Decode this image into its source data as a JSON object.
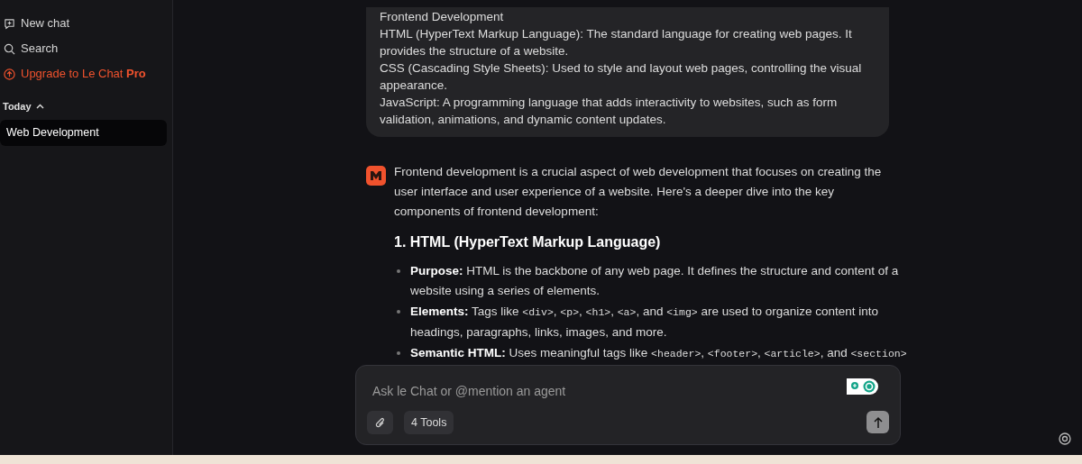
{
  "sidebar": {
    "actions": [
      {
        "kind": "new_chat",
        "label": "New chat"
      },
      {
        "kind": "search",
        "label": "Search"
      },
      {
        "kind": "upgrade",
        "label": "Upgrade to Le Chat **Pro**"
      }
    ],
    "section": {
      "title": "Today",
      "expanded": true
    },
    "chats": [
      {
        "title": "Web Development",
        "selected": true
      }
    ]
  },
  "user_message": {
    "lines": [
      "Frontend Development",
      "HTML (HyperText Markup Language): The standard language for creating web pages. It provides the structure of a website.",
      "CSS (Cascading Style Sheets): Used to style and layout web pages, controlling the visual appearance.",
      "JavaScript: A programming language that adds interactivity to websites, such as form validation, animations, and dynamic content updates."
    ]
  },
  "assistant_message": {
    "blocks": [
      {
        "kind": "paragraph",
        "text": "Frontend development is a crucial aspect of web development that focuses on creating the user interface and user experience of a website. Here's a deeper dive into the key components of frontend development:"
      },
      {
        "kind": "heading",
        "text": "1. HTML (HyperText Markup Language)"
      },
      {
        "kind": "list",
        "items": [
          {
            "label": "Purpose:",
            "parts": [
              {
                "kind": "text",
                "text": " HTML is the backbone of any web page. It defines the structure and content of a website using a series of elements."
              }
            ]
          },
          {
            "label": "Elements:",
            "parts": [
              {
                "kind": "text",
                "text": " Tags like "
              },
              {
                "kind": "code",
                "text": "<div>"
              },
              {
                "kind": "text",
                "text": ", "
              },
              {
                "kind": "code",
                "text": "<p>"
              },
              {
                "kind": "text",
                "text": ", "
              },
              {
                "kind": "code",
                "text": "<h1>"
              },
              {
                "kind": "text",
                "text": ", "
              },
              {
                "kind": "code",
                "text": "<a>"
              },
              {
                "kind": "text",
                "text": ", and "
              },
              {
                "kind": "code",
                "text": "<img>"
              },
              {
                "kind": "text",
                "text": " are used to organize content into headings, paragraphs, links, images, and more."
              }
            ]
          },
          {
            "label": "Semantic HTML:",
            "parts": [
              {
                "kind": "text",
                "text": " Uses meaningful tags like "
              },
              {
                "kind": "code",
                "text": "<header>"
              },
              {
                "kind": "text",
                "text": ", "
              },
              {
                "kind": "code",
                "text": "<footer>"
              },
              {
                "kind": "text",
                "text": ", "
              },
              {
                "kind": "code",
                "text": "<article>"
              },
              {
                "kind": "text",
                "text": ", and "
              },
              {
                "kind": "code",
                "text": "<section>"
              }
            ]
          }
        ]
      }
    ]
  },
  "composer": {
    "placeholder": "Ask le Chat or @mention an agent",
    "tools_label": "4 Tools"
  }
}
